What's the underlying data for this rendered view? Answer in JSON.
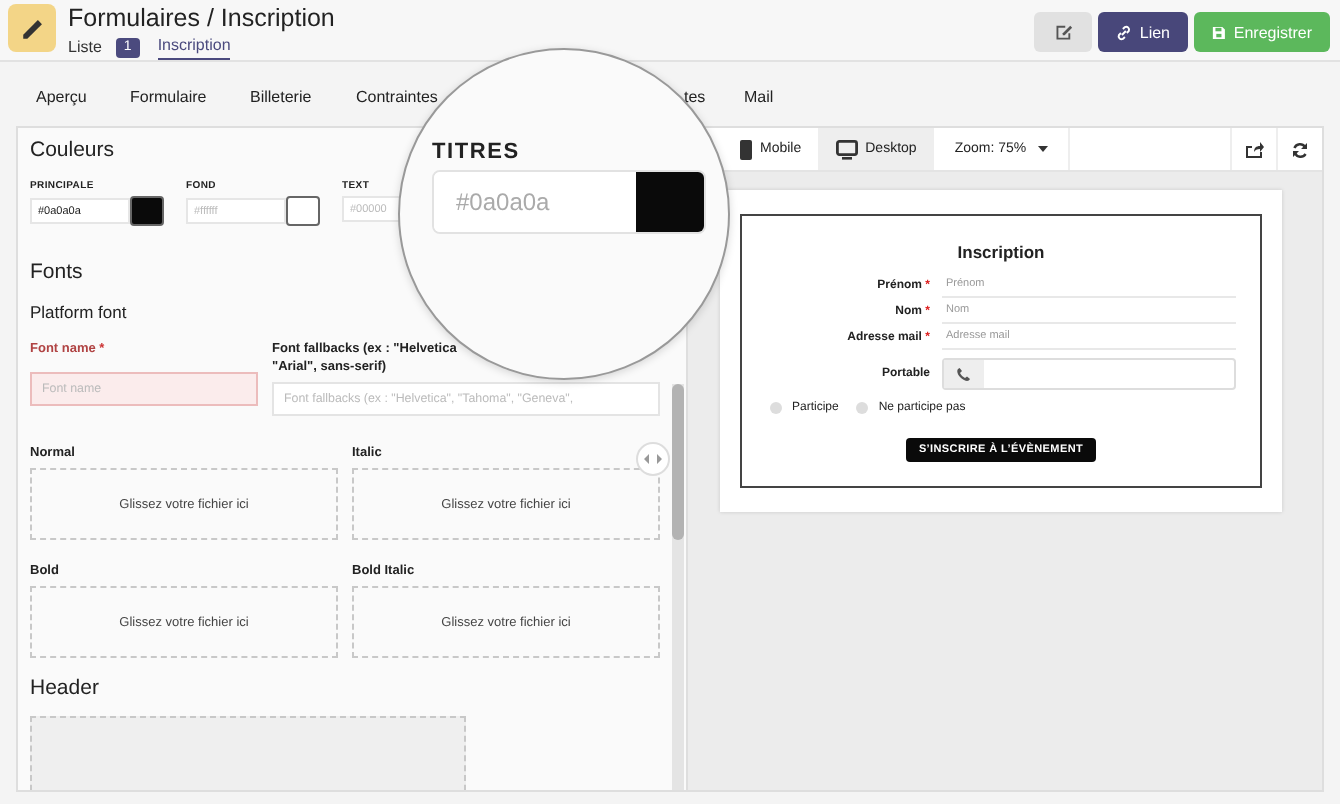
{
  "header": {
    "title": "Formulaires / Inscription",
    "breadcrumbs": [
      {
        "label": "Liste",
        "badge": "1",
        "selected": false
      },
      {
        "label": "Inscription",
        "selected": true
      }
    ],
    "buttons": [
      {
        "kind": "edit"
      },
      {
        "kind": "link",
        "label": "Lien"
      },
      {
        "kind": "save",
        "label": "Enregistrer"
      }
    ]
  },
  "tabs": [
    {
      "label": "Aperçu",
      "selected": false
    },
    {
      "label": "Formulaire",
      "selected": false
    },
    {
      "label": "Billeterie",
      "selected": false
    },
    {
      "label": "Contraintes",
      "selected": false
    },
    {
      "label": "tes",
      "selected": false
    },
    {
      "label": "Mail",
      "selected": false
    }
  ],
  "editor": {
    "colors_title": "Couleurs",
    "colors": [
      {
        "label": "PRINCIPALE",
        "value": "#0a0a0a",
        "color": "#0a0a0a"
      },
      {
        "label": "FOND",
        "placeholder": "#ffffff",
        "color": "#ffffff"
      },
      {
        "label": "TEXT",
        "placeholder": "#00000"
      }
    ],
    "fonts_title": "Fonts",
    "subtitle": "Platform font",
    "font_name": {
      "label": "Font name",
      "required": true,
      "required_mark": "*",
      "invalid": true,
      "placeholder": "Font name"
    },
    "fallbacks": {
      "label_lines": [
        "Font fallbacks (ex : \"Helvetica",
        "\"Arial\", sans-serif)"
      ],
      "placeholder": "Font fallbacks (ex : \"Helvetica\", \"Tahoma\", \"Geneva\","
    },
    "drop_zones": [
      {
        "label": "Normal",
        "hint": "Glissez votre fichier ici"
      },
      {
        "label": "Italic",
        "hint": "Glissez votre fichier ici"
      },
      {
        "label": "Bold",
        "hint": "Glissez votre fichier ici"
      },
      {
        "label": "Bold Italic",
        "hint": "Glissez votre fichier ici"
      }
    ],
    "header_title": "Header"
  },
  "preview": {
    "devices": [
      {
        "kind": "mobile",
        "label": "Mobile",
        "selected": false
      },
      {
        "kind": "desktop",
        "label": "Desktop",
        "selected": true
      }
    ],
    "zoom": "Zoom: 75%",
    "form": {
      "title": "Inscription",
      "fields": [
        {
          "label": "Prénom",
          "required": true,
          "required_mark": "*",
          "placeholder": "Prénom"
        },
        {
          "label": "Nom",
          "required": true,
          "required_mark": "*",
          "placeholder": "Nom"
        },
        {
          "label": "Adresse mail",
          "required": true,
          "required_mark": "*",
          "placeholder": "Adresse mail"
        }
      ],
      "phone": {
        "label": "Portable"
      },
      "radios": [
        {
          "label": "Participe",
          "selected": false
        },
        {
          "label": "Ne participe pas",
          "selected": false
        }
      ],
      "submit": "S’INSCRIRE À L’ÉVÈNEMENT"
    }
  },
  "magnifier": {
    "label": "TITRES",
    "value": "#0a0a0a",
    "color": "#0a0a0a"
  }
}
